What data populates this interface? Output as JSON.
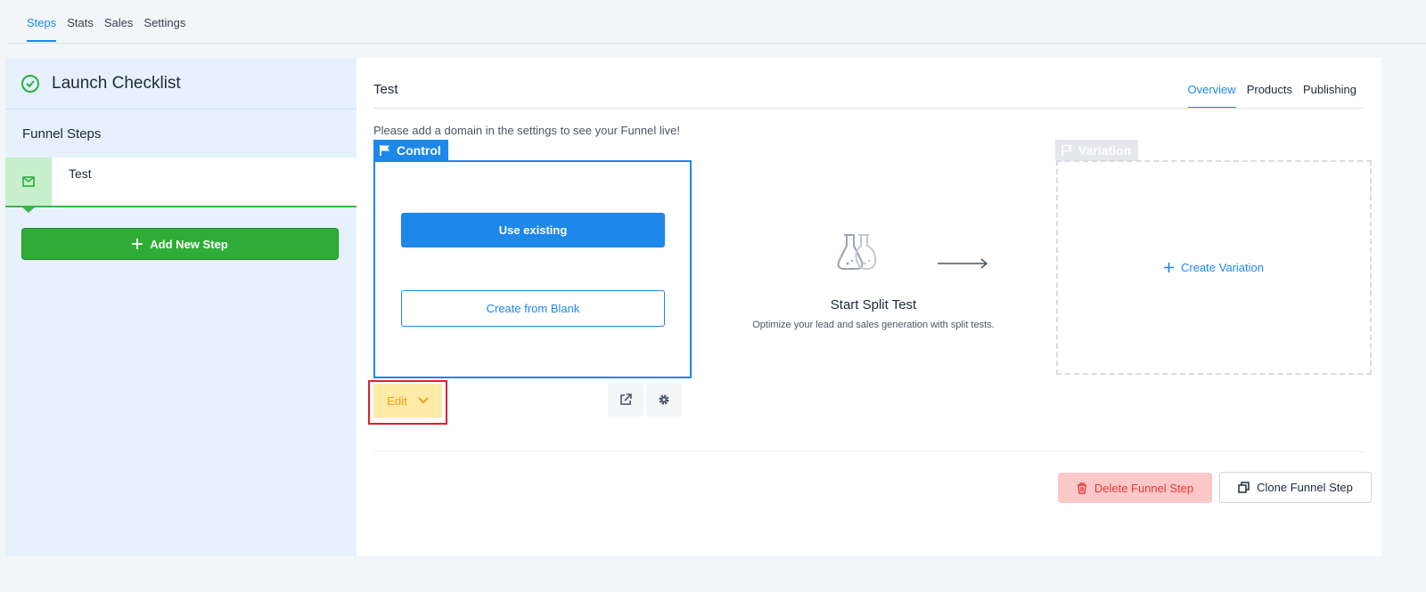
{
  "top_tabs": [
    {
      "label": "Steps",
      "active": true
    },
    {
      "label": "Stats",
      "active": false
    },
    {
      "label": "Sales",
      "active": false
    },
    {
      "label": "Settings",
      "active": false
    }
  ],
  "sidebar": {
    "title": "Launch Checklist",
    "title_icon": "check-circle-icon",
    "section_label": "Funnel Steps",
    "steps": [
      {
        "name": "Test",
        "icon": "mail-icon"
      }
    ],
    "add_step_label": "Add New Step"
  },
  "main": {
    "title": "Test",
    "tabs": [
      {
        "label": "Overview",
        "active": true
      },
      {
        "label": "Products",
        "active": false
      },
      {
        "label": "Publishing",
        "active": false
      }
    ],
    "notice": "Please add a domain in the settings to see your Funnel live!",
    "control": {
      "label": "Control",
      "use_existing_label": "Use existing",
      "create_blank_label": "Create from Blank",
      "edit_label": "Edit"
    },
    "split_test": {
      "title": "Start Split Test",
      "description": "Optimize your lead and sales generation with split tests."
    },
    "variation": {
      "label": "Variation",
      "create_label": "Create Variation"
    },
    "delete_label": "Delete Funnel Step",
    "clone_label": "Clone Funnel Step"
  },
  "colors": {
    "accent": "#1d87ea",
    "success": "#2fac37",
    "danger": "#e5383b",
    "warning": "#e8a20f",
    "highlight_outline": "#e0202a"
  }
}
